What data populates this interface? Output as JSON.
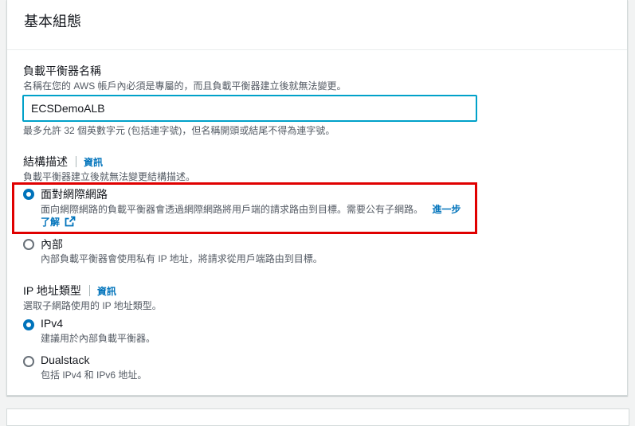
{
  "section": {
    "title": "基本組態"
  },
  "lb_name": {
    "label": "負載平衡器名稱",
    "description": "名稱在您的 AWS 帳戶內必須是專屬的，而且負載平衡器建立後就無法變更。",
    "value": "ECSDemoALB",
    "hint": "最多允許 32 個英數字元 (包括連字號)，但名稱開頭或結尾不得為連字號。"
  },
  "scheme": {
    "label": "結構描述",
    "info": "資訊",
    "description": "負載平衡器建立後就無法變更結構描述。",
    "options": [
      {
        "label": "面對網際網路",
        "description_line1": "面向網際網路的負載平衡器會透過網際網路將用戶端的請求路由到目標。需要公有子網路。",
        "learn_more_1": "進一步",
        "learn_more_2": "了解",
        "selected": true
      },
      {
        "label": "內部",
        "description": "內部負載平衡器會使用私有 IP 地址，將請求從用戶端路由到目標。",
        "selected": false
      }
    ]
  },
  "ip_type": {
    "label": "IP 地址類型",
    "info": "資訊",
    "description": "選取子網路使用的 IP 地址類型。",
    "options": [
      {
        "label": "IPv4",
        "description": "建議用於內部負載平衡器。",
        "selected": true
      },
      {
        "label": "Dualstack",
        "description": "包括 IPv4 和 IPv6 地址。",
        "selected": false
      }
    ]
  },
  "colors": {
    "accent": "#0073bb",
    "focus": "#00a1c9",
    "highlight": "#e00000"
  },
  "icons": {
    "external_link": "external-link-icon"
  }
}
